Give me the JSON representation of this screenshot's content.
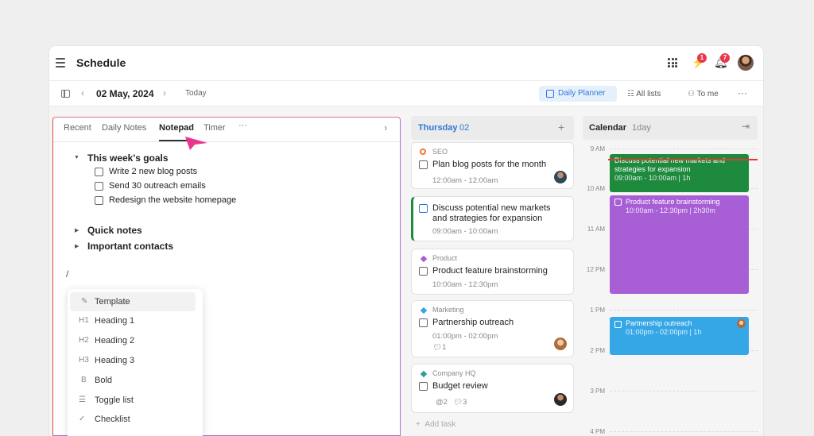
{
  "header": {
    "title": "Schedule",
    "notifications": {
      "activity_count": "1",
      "bell_count": "7"
    }
  },
  "subbar": {
    "date": "02 May, 2024",
    "today_label": "Today",
    "daily_planner_label": "Daily Planner",
    "all_lists_label": "All lists",
    "to_me_label": "To me"
  },
  "notepad": {
    "tabs": [
      "Recent",
      "Daily Notes",
      "Notepad",
      "Timer",
      "···"
    ],
    "goals_heading": "This week's goals",
    "goals": [
      "Write 2 new blog posts",
      "Send 30 outreach emails",
      "Redesign the website homepage"
    ],
    "quick_notes": "Quick notes",
    "important_contacts": "Important contacts",
    "slash": "/",
    "command_menu": [
      {
        "icon": "✎",
        "label": "Template"
      },
      {
        "icon": "H1",
        "label": "Heading 1"
      },
      {
        "icon": "H2",
        "label": "Heading 2"
      },
      {
        "icon": "H3",
        "label": "Heading 3"
      },
      {
        "icon": "B",
        "label": "Bold"
      },
      {
        "icon": "☰",
        "label": "Toggle list"
      },
      {
        "icon": "✓",
        "label": "Checklist"
      }
    ]
  },
  "day_column": {
    "day": "Thursday",
    "date": "02",
    "add_task": "Add task",
    "tasks": [
      {
        "category": "SEO",
        "title": "Plan blog posts for the month",
        "time": "12:00am - 12:00am"
      },
      {
        "category": "",
        "title": "Discuss potential new markets and strategies for expansion",
        "time": "09:00am - 10:00am"
      },
      {
        "category": "Product",
        "title": "Product feature brainstorming",
        "time": "10:00am - 12:30pm"
      },
      {
        "category": "Marketing",
        "title": "Partnership outreach",
        "time": "01:00pm - 02:00pm",
        "comments": "1"
      },
      {
        "category": "Company HQ",
        "title": "Budget review",
        "mentions": "2",
        "comments": "3"
      }
    ]
  },
  "calendar": {
    "title": "Calendar",
    "range": "1day",
    "hours": [
      "9 AM",
      "10 AM",
      "11 AM",
      "12 PM",
      "1 PM",
      "2 PM",
      "3 PM",
      "4 PM"
    ],
    "events": [
      {
        "title": "Discuss potential new markets and strategies for expansion",
        "time": "09:00am - 10:00am | 1h",
        "color": "#1e8a3e"
      },
      {
        "title": "Product feature brainstorming",
        "time": "10:00am - 12:30pm | 2h30m",
        "color": "#a85fd6"
      },
      {
        "title": "Partnership outreach",
        "time": "01:00pm - 02:00pm | 1h",
        "color": "#35a7e6"
      }
    ]
  },
  "colors": {
    "accent": "#2f78d8",
    "notepad_cursor": "#e8368f"
  }
}
